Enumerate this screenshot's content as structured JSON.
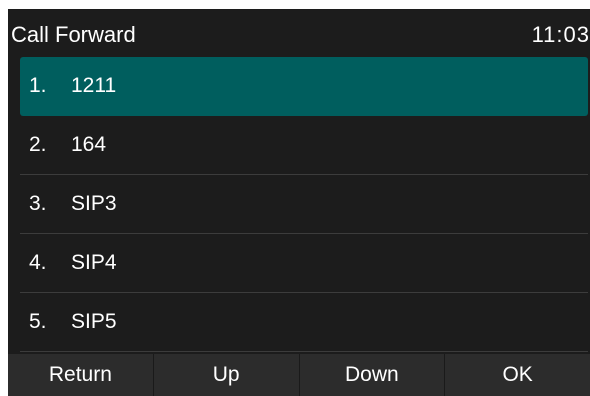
{
  "header": {
    "title": "Call Forward",
    "time": "11:03"
  },
  "accounts": [
    {
      "index": "1.",
      "name": "1211",
      "selected": true
    },
    {
      "index": "2.",
      "name": "164",
      "selected": false
    },
    {
      "index": "3.",
      "name": "SIP3",
      "selected": false
    },
    {
      "index": "4.",
      "name": "SIP4",
      "selected": false
    },
    {
      "index": "5.",
      "name": "SIP5",
      "selected": false
    }
  ],
  "softkeys": {
    "return_label": "Return",
    "up_label": "Up",
    "down_label": "Down",
    "ok_label": "OK"
  },
  "colors": {
    "background": "#1c1c1c",
    "selection": "#005e5e",
    "softkey_bar": "#2c2c2c",
    "text": "#ffffff"
  }
}
